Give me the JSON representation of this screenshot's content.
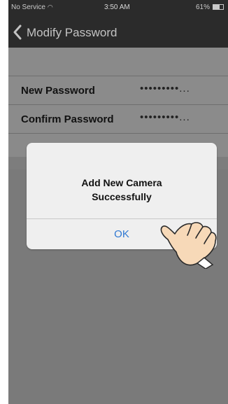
{
  "status_bar": {
    "carrier": "No Service",
    "time": "3:50 AM",
    "battery": "61%",
    "battery_level": 0.61,
    "wifi_icon": "wifi-icon",
    "battery_icon": "battery-icon"
  },
  "nav": {
    "back_icon": "chevron-left-icon",
    "title": "Modify Password"
  },
  "form": {
    "new_password": {
      "label": "New Password",
      "value": "•••••••••..."
    },
    "confirm_password": {
      "label": "Confirm Password",
      "value": "•••••••••..."
    }
  },
  "alert": {
    "title": "Add New Camera\nSuccessfully",
    "title_line1": "Add New Camera",
    "title_line2": "Successfully",
    "ok_label": "OK"
  },
  "pointer": {
    "icon": "pointing-hand-icon"
  },
  "colors": {
    "bar_background": "#2b2b2b",
    "dimmed_background": "#8a8a8a",
    "alert_background": "#efefef",
    "ok_accent": "#2f78d2"
  }
}
